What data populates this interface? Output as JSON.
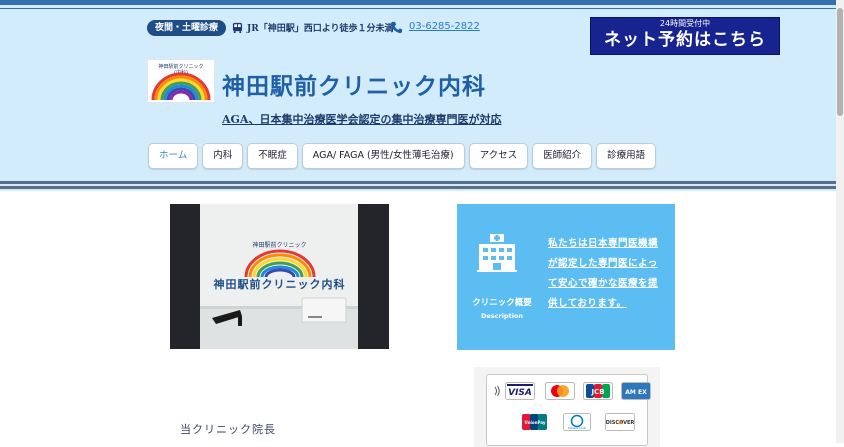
{
  "header": {
    "night_badge": "夜間・土曜診療",
    "access": "JR「神田駅」西口より徒歩１分未満",
    "phone": "03-6285-2822",
    "reserve_sub": "24時間受付中",
    "reserve_main": "ネット予約はこちら",
    "clinic_name": "神田駅前クリニック内科",
    "tagline": "AGA、日本集中治療医学会認定の集中治療専門医が対応",
    "logo_caption_1": "神田駅前クリニック",
    "logo_caption_2": "(内科)"
  },
  "nav": {
    "items": [
      "ホーム",
      "内科",
      "不眠症",
      "AGA/ FAGA (男性/女性薄毛治療)",
      "アクセス",
      "医師紹介",
      "診療用語"
    ],
    "active_index": 0
  },
  "photo": {
    "caption_small": "神田駅前クリニック",
    "clinic_name": "神田駅前クリニック内科"
  },
  "info_card": {
    "title": "クリニック概要",
    "title_en": "Description",
    "text": "私たちは日本専門医機構が認定した専門医によって安心で確かな医療を提供しております。"
  },
  "payment": {
    "cards": [
      "visa",
      "mastercard",
      "jcb",
      "amex",
      "unionpay",
      "diners-club",
      "discover"
    ],
    "labels": {
      "visa": "VISA",
      "jcb": "JCB",
      "amex": "AM EX",
      "unionpay": "UnionPay",
      "diners": "Diners Club",
      "discover": "DISCOVER"
    }
  },
  "director": {
    "heading": "当クリニック院長"
  },
  "colors": {
    "header_bg": "#d2ecfb",
    "brand_blue": "#1f5fa8",
    "reserve_bg": "#17238e",
    "card_bg": "#5cbdf2"
  }
}
